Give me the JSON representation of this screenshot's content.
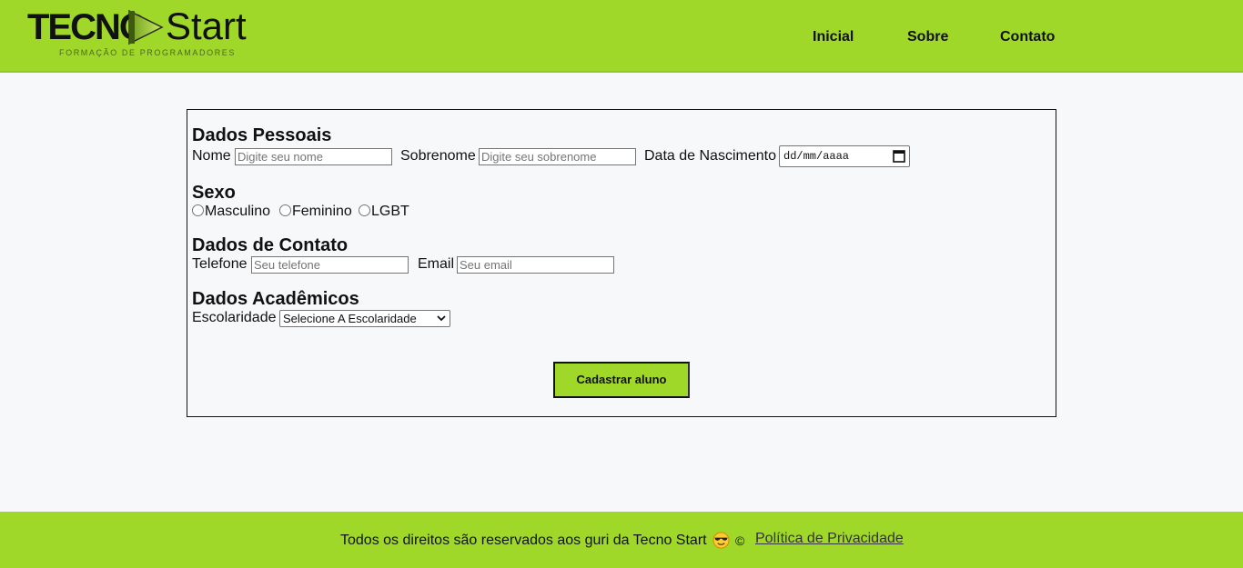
{
  "brand": {
    "name_bold": "TECNO",
    "name_light": "Start",
    "tagline": "FORMAÇÃO DE PROGRAMADORES",
    "accent": "#a0d82a"
  },
  "nav": {
    "items": [
      {
        "label": "Inicial"
      },
      {
        "label": "Sobre"
      },
      {
        "label": "Contato"
      }
    ]
  },
  "form": {
    "personal": {
      "title": "Dados Pessoais",
      "first_name_label": "Nome",
      "first_name_placeholder": "Digite seu nome",
      "last_name_label": "Sobrenome",
      "last_name_placeholder": "Digite seu sobrenome",
      "birth_label": "Data de Nascimento",
      "birth_placeholder": "dd/mm/aaaa"
    },
    "gender": {
      "title": "Sexo",
      "options": [
        {
          "label": "Masculino"
        },
        {
          "label": "Feminino"
        },
        {
          "label": "LGBT"
        }
      ]
    },
    "contact": {
      "title": "Dados de Contato",
      "phone_label": "Telefone",
      "phone_placeholder": "Seu telefone",
      "email_label": "Email",
      "email_placeholder": "Seu email"
    },
    "academic": {
      "title": "Dados Acadêmicos",
      "education_label": "Escolaridade",
      "education_selected": "Selecione A Escolaridade"
    },
    "submit_label": "Cadastrar aluno"
  },
  "footer": {
    "text": "Todos os direitos são reservados aos guri da Tecno Start",
    "emoji": "cool-sunglasses-emoji",
    "copyright": "©",
    "privacy_link": "Política de Privacidade"
  }
}
